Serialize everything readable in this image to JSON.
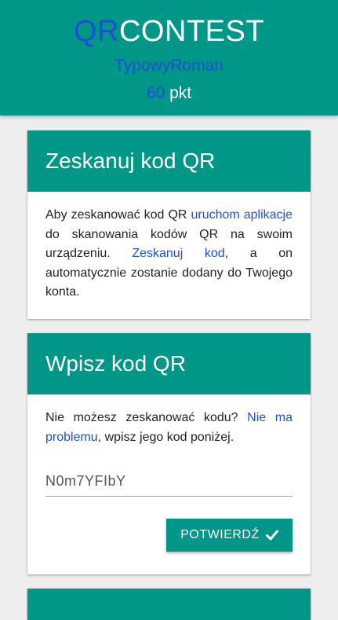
{
  "header": {
    "brand_prefix": "QR",
    "brand_suffix": "CONTEST",
    "username": "TypowyRoman",
    "points_value": "60",
    "points_unit": "pkt"
  },
  "scan_card": {
    "title": "Zeskanuj kod QR",
    "text_1": "Aby zeskanować kod QR ",
    "link_1": "uruchom aplikacje",
    "text_2": " do skanowania kodów QR na swoim urządzeniu. ",
    "link_2": "Zeskanuj kod",
    "text_3": ", a on automatycznie zostanie dodany do Twojego konta."
  },
  "enter_card": {
    "title": "Wpisz kod QR",
    "text_1": "Nie możesz zeskanować kodu? ",
    "link_1": "Nie ma problemu",
    "text_2": ", wpisz jego kod poniżej.",
    "input_value": "N0m7YFIbY",
    "confirm_label": "POTWIERDŹ"
  },
  "icons": {
    "confirm": "check-icon"
  },
  "colors": {
    "primary": "#009688",
    "accent_blue": "#1e4fd8",
    "background": "#eeeeee"
  }
}
